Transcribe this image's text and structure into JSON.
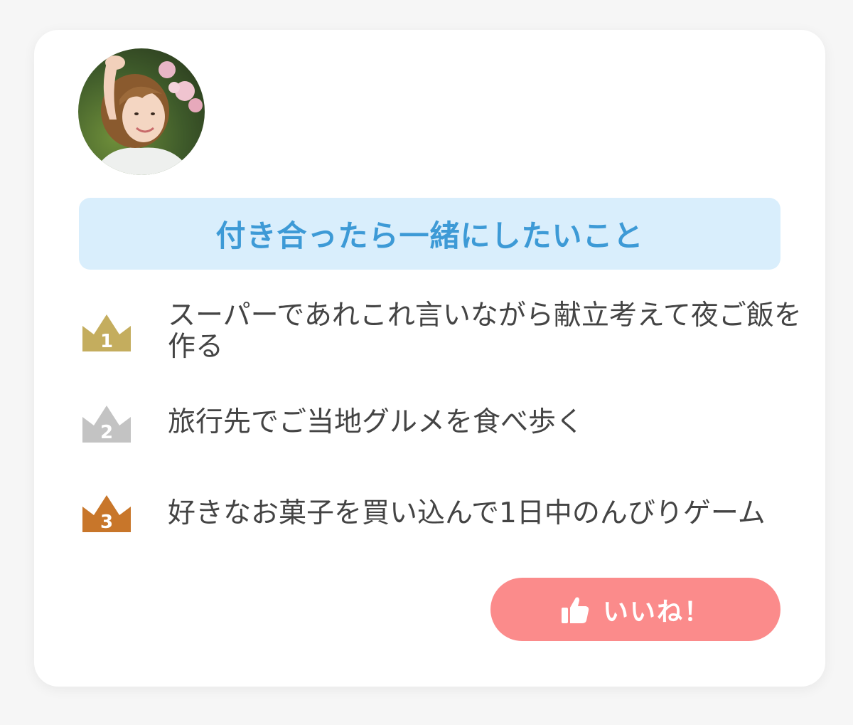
{
  "profile": {
    "avatar_alt": "profile-photo"
  },
  "section": {
    "title": "付き合ったら一緒にしたいこと"
  },
  "ranking": [
    {
      "rank": "1",
      "text": "スーパーであれこれ言いながら献立考えて夜ご飯を作る",
      "color": "#c4ad5e"
    },
    {
      "rank": "2",
      "text": "旅行先でご当地グルメを食べ歩く",
      "color": "#c3c3c3"
    },
    {
      "rank": "3",
      "text": "好きなお菓子を買い込んで1日中のんびりゲーム",
      "color": "#c8762a"
    }
  ],
  "like_button": {
    "label": "いいね！",
    "icon": "thumbs-up-icon",
    "color": "#fb8b8b"
  },
  "colors": {
    "accent_blue": "#3d9ad6",
    "title_bg": "#d9eefc",
    "text": "#444444"
  }
}
